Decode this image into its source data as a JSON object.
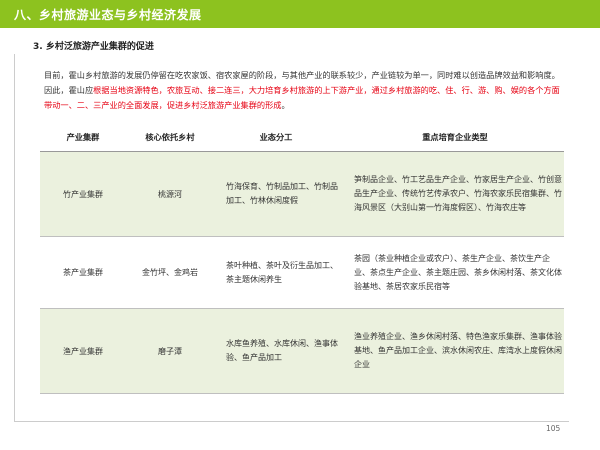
{
  "header": {
    "title": "八、乡村旅游业态与乡村经济发展"
  },
  "section": {
    "title": "3. 乡村泛旅游产业集群的促进"
  },
  "intro": {
    "p1": "目前，霍山乡村旅游的发展仍停留在吃农家饭、宿农家屋的阶段，与其他产业的联系较少，产业链较为单一，同时难以创造品牌效益和影响度。因此，霍山应",
    "red1": "根据当地资源特色，农旅互动、接二连三，大力培育乡村旅游的上下游产业，通过乡村旅游的吃、住、行、游、购、娱的各个方面带动一、二、三产业的全面发展，促进乡村泛旅游产业集群的形成",
    "end": "。"
  },
  "table": {
    "headers": [
      "产业集群",
      "核心依托乡村",
      "业态分工",
      "重点培育企业类型"
    ],
    "rows": [
      {
        "cluster": "竹产业集群",
        "village": "桃源河",
        "division": "竹海保育、竹制品加工、竹制品加工、竹林休闲度假",
        "enterprises": "笋制品企业、竹工艺品生产企业、竹家居生产企业、竹创意品生产企业、传统竹艺传承农户、竹海农家乐民宿集群、竹海风景区（大别山第一竹海度假区）、竹海农庄等"
      },
      {
        "cluster": "茶产业集群",
        "village": "金竹坪、金鸡岩",
        "division": "茶叶种植、茶叶及衍生品加工、茶主题休闲养生",
        "enterprises": "茶园（茶业种植企业或农户）、茶生产企业、茶饮生产企业、茶点生产企业、茶主题庄园、茶乡休闲村落、茶文化体验基地、茶居农家乐民宿等"
      },
      {
        "cluster": "渔产业集群",
        "village": "磨子潭",
        "division": "水库鱼养殖、水库休闲、渔事体验、鱼产品加工",
        "enterprises": "渔业养殖企业、渔乡休闲村落、特色渔家乐集群、渔事体验基地、鱼产品加工企业、滨水休闲农庄、库湾水上度假休闲企业"
      }
    ]
  },
  "footer": {
    "page": "105"
  },
  "colors": {
    "accent": "#8dc21f",
    "highlight": "#e60012",
    "row_alt": "#ebf1de"
  }
}
